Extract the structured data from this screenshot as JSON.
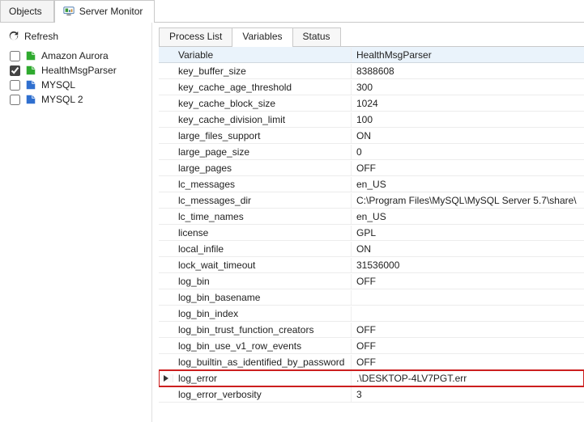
{
  "topTabs": {
    "objects": "Objects",
    "serverMonitor": "Server Monitor"
  },
  "sidebar": {
    "refresh": "Refresh",
    "servers": [
      {
        "label": "Amazon Aurora",
        "checked": false,
        "color": "green"
      },
      {
        "label": "HealthMsgParser",
        "checked": true,
        "color": "green"
      },
      {
        "label": "MYSQL",
        "checked": false,
        "color": "blue"
      },
      {
        "label": "MYSQL 2",
        "checked": false,
        "color": "blue"
      }
    ]
  },
  "subTabs": {
    "processList": "Process List",
    "variables": "Variables",
    "status": "Status"
  },
  "grid": {
    "colVariable": "Variable",
    "colValueHeader": "HealthMsgParser",
    "rows": [
      {
        "name": "key_buffer_size",
        "value": "8388608"
      },
      {
        "name": "key_cache_age_threshold",
        "value": "300"
      },
      {
        "name": "key_cache_block_size",
        "value": "1024"
      },
      {
        "name": "key_cache_division_limit",
        "value": "100"
      },
      {
        "name": "large_files_support",
        "value": "ON"
      },
      {
        "name": "large_page_size",
        "value": "0"
      },
      {
        "name": "large_pages",
        "value": "OFF"
      },
      {
        "name": "lc_messages",
        "value": "en_US"
      },
      {
        "name": "lc_messages_dir",
        "value": "C:\\Program Files\\MySQL\\MySQL Server 5.7\\share\\"
      },
      {
        "name": "lc_time_names",
        "value": "en_US"
      },
      {
        "name": "license",
        "value": "GPL"
      },
      {
        "name": "local_infile",
        "value": "ON"
      },
      {
        "name": "lock_wait_timeout",
        "value": "31536000"
      },
      {
        "name": "log_bin",
        "value": "OFF"
      },
      {
        "name": "log_bin_basename",
        "value": ""
      },
      {
        "name": "log_bin_index",
        "value": ""
      },
      {
        "name": "log_bin_trust_function_creators",
        "value": "OFF"
      },
      {
        "name": "log_bin_use_v1_row_events",
        "value": "OFF"
      },
      {
        "name": "log_builtin_as_identified_by_password",
        "value": "OFF"
      },
      {
        "name": "log_error",
        "value": ".\\DESKTOP-4LV7PGT.err",
        "selected": true
      },
      {
        "name": "log_error_verbosity",
        "value": "3"
      }
    ]
  }
}
